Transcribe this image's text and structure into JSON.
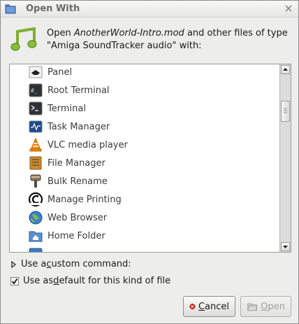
{
  "window": {
    "title": "Open With"
  },
  "header": {
    "prefix": "Open ",
    "filename": "AnotherWorld-Intro.mod",
    "suffix": " and other files of type",
    "line2": "\"Amiga SoundTracker audio\" with:"
  },
  "apps": [
    {
      "label": "Panel",
      "icon": "panel-icon"
    },
    {
      "label": "Root Terminal",
      "icon": "root-terminal-icon"
    },
    {
      "label": "Terminal",
      "icon": "terminal-icon"
    },
    {
      "label": "Task Manager",
      "icon": "task-manager-icon"
    },
    {
      "label": "VLC media player",
      "icon": "vlc-icon"
    },
    {
      "label": "File Manager",
      "icon": "file-manager-icon"
    },
    {
      "label": "Bulk Rename",
      "icon": "bulk-rename-icon"
    },
    {
      "label": "Manage Printing",
      "icon": "printing-icon"
    },
    {
      "label": "Web Browser",
      "icon": "web-browser-icon"
    },
    {
      "label": "Home Folder",
      "icon": "home-folder-icon"
    },
    {
      "label": "",
      "icon": "partial-item-icon"
    }
  ],
  "expander": {
    "pre": "Use a ",
    "mnemonic": "c",
    "post": "ustom command:"
  },
  "default_check": {
    "pre": "Use as ",
    "mnemonic": "d",
    "post": "efault for this kind of file",
    "checked": true
  },
  "buttons": {
    "cancel": {
      "mnemonic": "C",
      "rest": "ancel"
    },
    "open": {
      "mnemonic": "O",
      "rest": "pen"
    }
  }
}
